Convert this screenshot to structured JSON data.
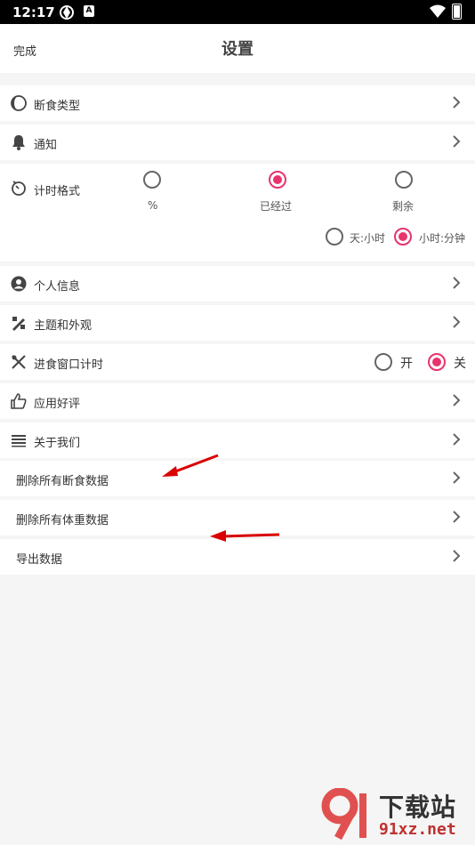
{
  "status_bar": {
    "time": "12:17",
    "badge": "A"
  },
  "header": {
    "done_label": "完成",
    "title": "设置"
  },
  "rows": {
    "fasting_type": "断食类型",
    "notifications": "通知",
    "timer_format": "计时格式",
    "personal_info": "个人信息",
    "theme": "主题和外观",
    "eating_window": "进食窗口计时",
    "rate_app": "应用好评",
    "about": "关于我们",
    "delete_fasting": "删除所有断食数据",
    "delete_weight": "删除所有体重数据",
    "export": "导出数据"
  },
  "timer_format": {
    "options": [
      "%",
      "已经过",
      "剩余"
    ],
    "selected": "已经过",
    "unit_options": [
      "天:小时",
      "小时:分钟"
    ],
    "unit_selected": "小时:分钟"
  },
  "eating_window": {
    "on_label": "开",
    "off_label": "关",
    "selected": "关"
  },
  "watermark": {
    "brand": "下载站",
    "url": "91xz.net"
  },
  "colors": {
    "accent": "#e8336d",
    "annotation_arrow": "#d90000"
  }
}
